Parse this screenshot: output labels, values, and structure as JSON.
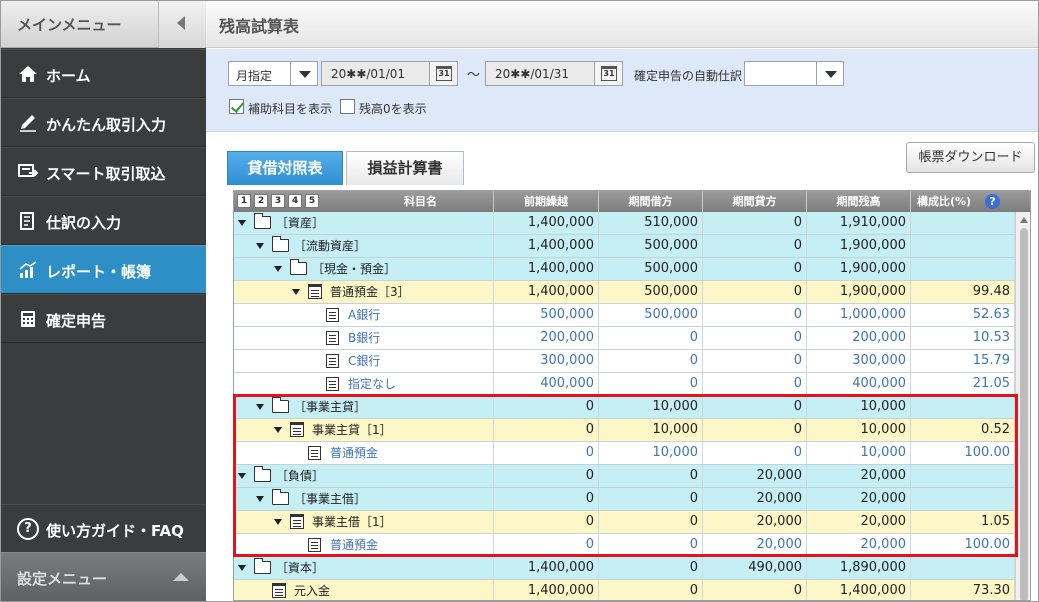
{
  "sidebar": {
    "header": "メインメニュー",
    "items": [
      {
        "label": "ホーム",
        "icon": "home-icon"
      },
      {
        "label": "かんたん取引入力",
        "icon": "pen-icon"
      },
      {
        "label": "スマート取引取込",
        "icon": "import-icon"
      },
      {
        "label": "仕訳の入力",
        "icon": "journal-icon"
      },
      {
        "label": "レポート・帳簿",
        "icon": "chart-icon"
      },
      {
        "label": "確定申告",
        "icon": "calculator-icon"
      }
    ],
    "faq": "使い方ガイド・FAQ",
    "settings": "設定メニュー"
  },
  "page": {
    "title": "残高試算表"
  },
  "filter": {
    "period": "月指定",
    "from": "20✱✱/01/01",
    "tilde": "～",
    "to": "20✱✱/01/31",
    "cal_glyph": "31",
    "auto_label": "確定申告の自動仕訳",
    "auto_value": "",
    "show_sub": "補助科目を表示",
    "show_sub_checked": true,
    "show_zero": "残高0を表示",
    "show_zero_checked": false
  },
  "tabs": [
    "貸借対照表",
    "損益計算書"
  ],
  "download": "帳票ダウンロード",
  "table": {
    "levels": [
      "1",
      "2",
      "3",
      "4",
      "5"
    ],
    "headers": [
      "科目名",
      "前期繰越",
      "期間借方",
      "期間貸方",
      "期間残高",
      "構成比(%)"
    ],
    "help_glyph": "?",
    "rows": [
      {
        "name": "［資産］",
        "depth": 0,
        "icon": "folder",
        "kind": "acct",
        "expand": true,
        "v": [
          "1,400,000",
          "510,000",
          "0",
          "1,910,000",
          ""
        ]
      },
      {
        "name": "［流動資産］",
        "depth": 1,
        "icon": "folder",
        "kind": "acct",
        "expand": true,
        "v": [
          "1,400,000",
          "500,000",
          "0",
          "1,900,000",
          ""
        ]
      },
      {
        "name": "［現金・預金］",
        "depth": 2,
        "icon": "folder",
        "kind": "acct",
        "expand": true,
        "v": [
          "1,400,000",
          "500,000",
          "0",
          "1,900,000",
          ""
        ]
      },
      {
        "name": "普通預金［3］",
        "depth": 3,
        "icon": "clip",
        "kind": "sub",
        "expand": true,
        "v": [
          "1,400,000",
          "500,000",
          "0",
          "1,900,000",
          "99.48"
        ]
      },
      {
        "name": "A銀行",
        "depth": 4,
        "icon": "doc",
        "kind": "leaf",
        "expand": false,
        "v": [
          "500,000",
          "500,000",
          "0",
          "1,000,000",
          "52.63"
        ]
      },
      {
        "name": "B銀行",
        "depth": 4,
        "icon": "doc",
        "kind": "leaf",
        "expand": false,
        "v": [
          "200,000",
          "0",
          "0",
          "200,000",
          "10.53"
        ]
      },
      {
        "name": "C銀行",
        "depth": 4,
        "icon": "doc",
        "kind": "leaf",
        "expand": false,
        "v": [
          "300,000",
          "0",
          "0",
          "300,000",
          "15.79"
        ]
      },
      {
        "name": "指定なし",
        "depth": 4,
        "icon": "doc",
        "kind": "leaf",
        "expand": false,
        "v": [
          "400,000",
          "0",
          "0",
          "400,000",
          "21.05"
        ]
      },
      {
        "name": "［事業主貸］",
        "depth": 1,
        "icon": "folder",
        "kind": "acct",
        "expand": true,
        "v": [
          "0",
          "10,000",
          "0",
          "10,000",
          ""
        ]
      },
      {
        "name": "事業主貸［1］",
        "depth": 2,
        "icon": "clip",
        "kind": "sub",
        "expand": true,
        "v": [
          "0",
          "10,000",
          "0",
          "10,000",
          "0.52"
        ]
      },
      {
        "name": "普通預金",
        "depth": 3,
        "icon": "doc",
        "kind": "leaf",
        "expand": false,
        "v": [
          "0",
          "10,000",
          "0",
          "10,000",
          "100.00"
        ]
      },
      {
        "name": "［負債］",
        "depth": 0,
        "icon": "folder",
        "kind": "acct",
        "expand": true,
        "v": [
          "0",
          "0",
          "20,000",
          "20,000",
          ""
        ]
      },
      {
        "name": "［事業主借］",
        "depth": 1,
        "icon": "folder",
        "kind": "acct",
        "expand": true,
        "v": [
          "0",
          "0",
          "20,000",
          "20,000",
          ""
        ]
      },
      {
        "name": "事業主借［1］",
        "depth": 2,
        "icon": "clip",
        "kind": "sub",
        "expand": true,
        "v": [
          "0",
          "0",
          "20,000",
          "20,000",
          "1.05"
        ]
      },
      {
        "name": "普通預金",
        "depth": 3,
        "icon": "doc",
        "kind": "leaf",
        "expand": false,
        "v": [
          "0",
          "0",
          "20,000",
          "20,000",
          "100.00"
        ]
      },
      {
        "name": "［資本］",
        "depth": 0,
        "icon": "folder",
        "kind": "acct",
        "expand": true,
        "v": [
          "1,400,000",
          "0",
          "490,000",
          "1,890,000",
          ""
        ]
      },
      {
        "name": "元入金",
        "depth": 1,
        "icon": "clip",
        "kind": "sub",
        "expand": false,
        "v": [
          "1,400,000",
          "0",
          "0",
          "1,400,000",
          "73.30"
        ]
      }
    ]
  }
}
